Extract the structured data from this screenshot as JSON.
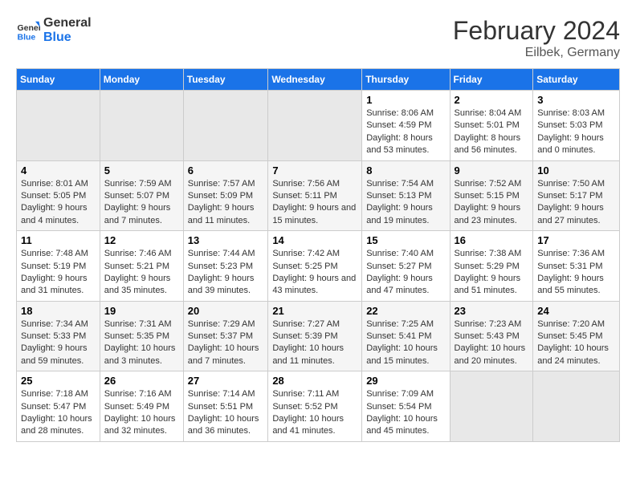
{
  "header": {
    "logo": {
      "line1": "General",
      "line2": "Blue"
    },
    "title": "February 2024",
    "subtitle": "Eilbek, Germany"
  },
  "days_of_week": [
    "Sunday",
    "Monday",
    "Tuesday",
    "Wednesday",
    "Thursday",
    "Friday",
    "Saturday"
  ],
  "weeks": [
    [
      {
        "day": "",
        "empty": true
      },
      {
        "day": "",
        "empty": true
      },
      {
        "day": "",
        "empty": true
      },
      {
        "day": "",
        "empty": true
      },
      {
        "day": "1",
        "sunrise": "8:06 AM",
        "sunset": "4:59 PM",
        "daylight": "8 hours and 53 minutes."
      },
      {
        "day": "2",
        "sunrise": "8:04 AM",
        "sunset": "5:01 PM",
        "daylight": "8 hours and 56 minutes."
      },
      {
        "day": "3",
        "sunrise": "8:03 AM",
        "sunset": "5:03 PM",
        "daylight": "9 hours and 0 minutes."
      }
    ],
    [
      {
        "day": "4",
        "sunrise": "8:01 AM",
        "sunset": "5:05 PM",
        "daylight": "9 hours and 4 minutes."
      },
      {
        "day": "5",
        "sunrise": "7:59 AM",
        "sunset": "5:07 PM",
        "daylight": "9 hours and 7 minutes."
      },
      {
        "day": "6",
        "sunrise": "7:57 AM",
        "sunset": "5:09 PM",
        "daylight": "9 hours and 11 minutes."
      },
      {
        "day": "7",
        "sunrise": "7:56 AM",
        "sunset": "5:11 PM",
        "daylight": "9 hours and 15 minutes."
      },
      {
        "day": "8",
        "sunrise": "7:54 AM",
        "sunset": "5:13 PM",
        "daylight": "9 hours and 19 minutes."
      },
      {
        "day": "9",
        "sunrise": "7:52 AM",
        "sunset": "5:15 PM",
        "daylight": "9 hours and 23 minutes."
      },
      {
        "day": "10",
        "sunrise": "7:50 AM",
        "sunset": "5:17 PM",
        "daylight": "9 hours and 27 minutes."
      }
    ],
    [
      {
        "day": "11",
        "sunrise": "7:48 AM",
        "sunset": "5:19 PM",
        "daylight": "9 hours and 31 minutes."
      },
      {
        "day": "12",
        "sunrise": "7:46 AM",
        "sunset": "5:21 PM",
        "daylight": "9 hours and 35 minutes."
      },
      {
        "day": "13",
        "sunrise": "7:44 AM",
        "sunset": "5:23 PM",
        "daylight": "9 hours and 39 minutes."
      },
      {
        "day": "14",
        "sunrise": "7:42 AM",
        "sunset": "5:25 PM",
        "daylight": "9 hours and 43 minutes."
      },
      {
        "day": "15",
        "sunrise": "7:40 AM",
        "sunset": "5:27 PM",
        "daylight": "9 hours and 47 minutes."
      },
      {
        "day": "16",
        "sunrise": "7:38 AM",
        "sunset": "5:29 PM",
        "daylight": "9 hours and 51 minutes."
      },
      {
        "day": "17",
        "sunrise": "7:36 AM",
        "sunset": "5:31 PM",
        "daylight": "9 hours and 55 minutes."
      }
    ],
    [
      {
        "day": "18",
        "sunrise": "7:34 AM",
        "sunset": "5:33 PM",
        "daylight": "9 hours and 59 minutes."
      },
      {
        "day": "19",
        "sunrise": "7:31 AM",
        "sunset": "5:35 PM",
        "daylight": "10 hours and 3 minutes."
      },
      {
        "day": "20",
        "sunrise": "7:29 AM",
        "sunset": "5:37 PM",
        "daylight": "10 hours and 7 minutes."
      },
      {
        "day": "21",
        "sunrise": "7:27 AM",
        "sunset": "5:39 PM",
        "daylight": "10 hours and 11 minutes."
      },
      {
        "day": "22",
        "sunrise": "7:25 AM",
        "sunset": "5:41 PM",
        "daylight": "10 hours and 15 minutes."
      },
      {
        "day": "23",
        "sunrise": "7:23 AM",
        "sunset": "5:43 PM",
        "daylight": "10 hours and 20 minutes."
      },
      {
        "day": "24",
        "sunrise": "7:20 AM",
        "sunset": "5:45 PM",
        "daylight": "10 hours and 24 minutes."
      }
    ],
    [
      {
        "day": "25",
        "sunrise": "7:18 AM",
        "sunset": "5:47 PM",
        "daylight": "10 hours and 28 minutes."
      },
      {
        "day": "26",
        "sunrise": "7:16 AM",
        "sunset": "5:49 PM",
        "daylight": "10 hours and 32 minutes."
      },
      {
        "day": "27",
        "sunrise": "7:14 AM",
        "sunset": "5:51 PM",
        "daylight": "10 hours and 36 minutes."
      },
      {
        "day": "28",
        "sunrise": "7:11 AM",
        "sunset": "5:52 PM",
        "daylight": "10 hours and 41 minutes."
      },
      {
        "day": "29",
        "sunrise": "7:09 AM",
        "sunset": "5:54 PM",
        "daylight": "10 hours and 45 minutes."
      },
      {
        "day": "",
        "empty": true
      },
      {
        "day": "",
        "empty": true
      }
    ]
  ],
  "labels": {
    "sunrise": "Sunrise:",
    "sunset": "Sunset:",
    "daylight": "Daylight:"
  }
}
